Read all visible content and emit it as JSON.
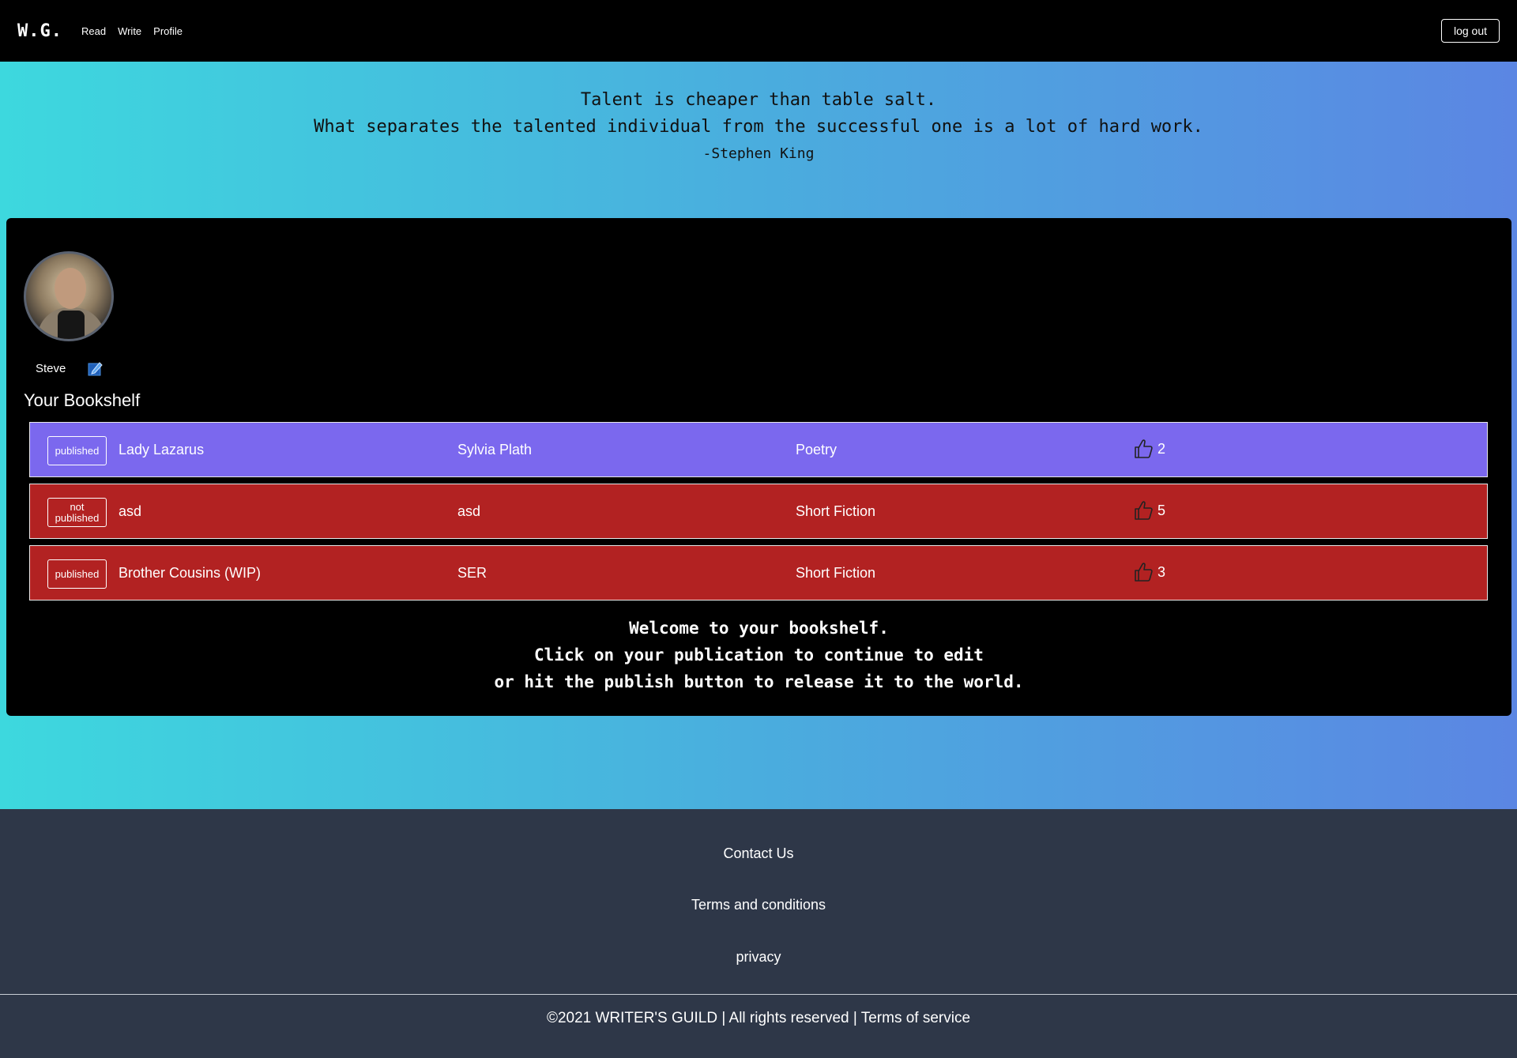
{
  "nav": {
    "brand": "W.G.",
    "links": [
      "Read",
      "Write",
      "Profile"
    ],
    "logout_label": "log out"
  },
  "quote": {
    "line1": "Talent is cheaper than table salt.",
    "line2": "What separates the talented individual from the successful one is a lot of hard work.",
    "author": "-Stephen King"
  },
  "profile": {
    "username": "Steve",
    "edit_icon": "edit-icon"
  },
  "bookshelf": {
    "title": "Your Bookshelf",
    "rows": [
      {
        "status": "published",
        "title": "Lady Lazarus",
        "author": "Sylvia Plath",
        "genre": "Poetry",
        "likes": "2",
        "color": "#7b68ee"
      },
      {
        "status": "not published",
        "title": "asd",
        "author": "asd",
        "genre": "Short Fiction",
        "likes": "5",
        "color": "#b22222"
      },
      {
        "status": "published",
        "title": "Brother Cousins (WIP)",
        "author": "SER",
        "genre": "Short Fiction",
        "likes": "3",
        "color": "#b22222"
      }
    ],
    "welcome": {
      "line1": "Welcome to your bookshelf.",
      "line2": "Click on your publication to continue to edit",
      "line3": "or hit the publish button to release it to the world."
    }
  },
  "footer": {
    "links": [
      "Contact Us",
      "Terms and conditions",
      "privacy"
    ],
    "copyright": "©2021 WRITER'S GUILD | All rights reserved | Terms of service"
  },
  "colors": {
    "nav_bg": "#000000",
    "gradient_start": "#3dd8de",
    "gradient_end": "#5b86e3",
    "published_row": "#7b68ee",
    "unpublished_row": "#b22222",
    "footer_bg": "#2e3748"
  }
}
